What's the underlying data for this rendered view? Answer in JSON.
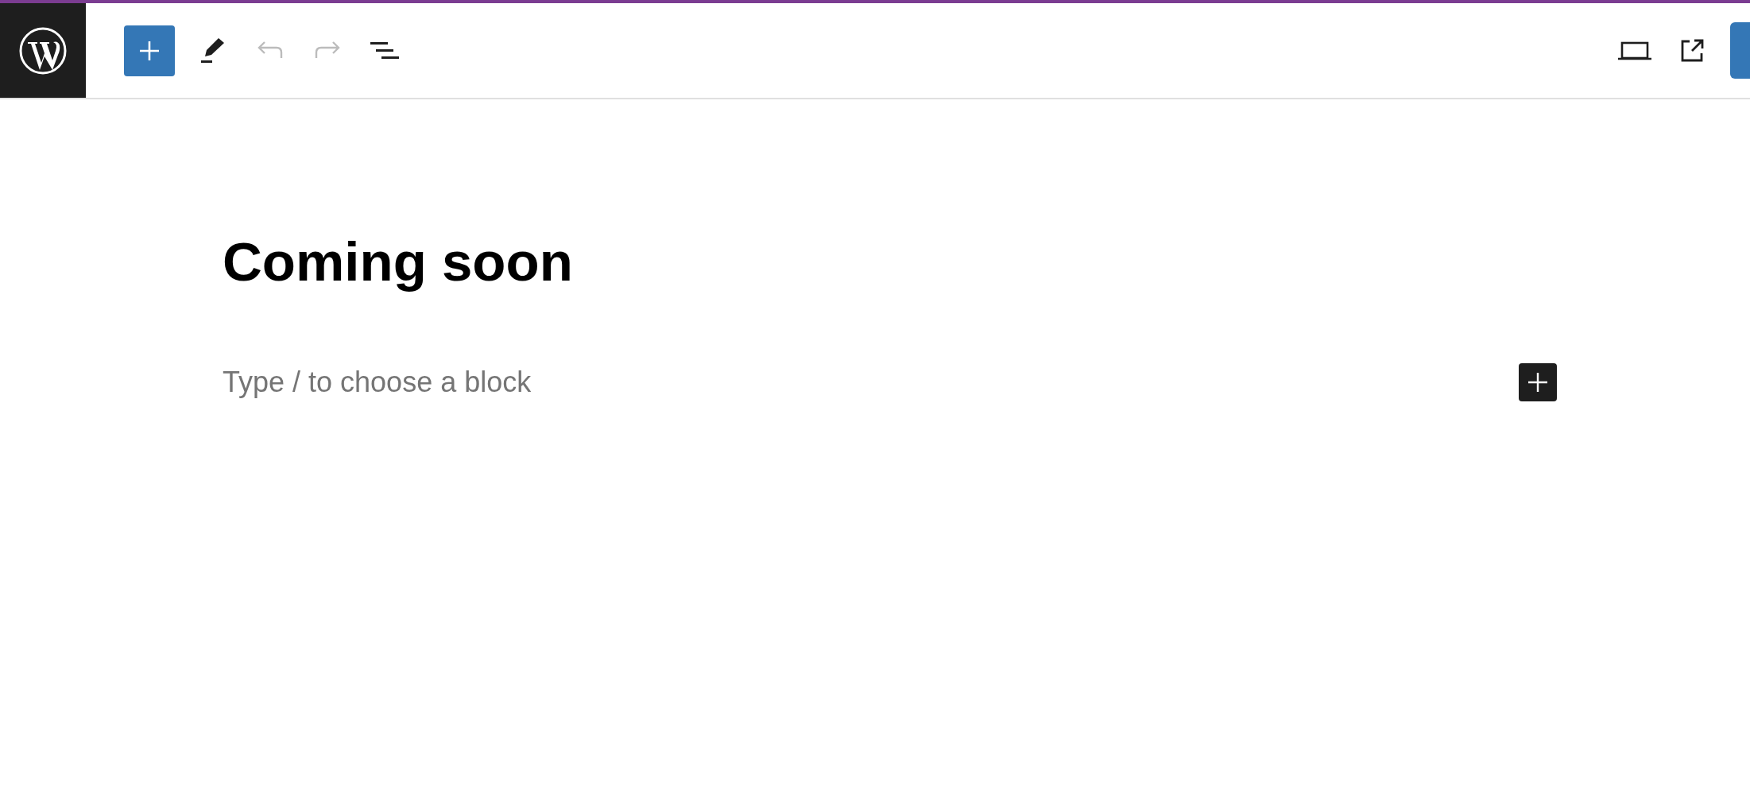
{
  "toolbar": {
    "undo": {
      "disabled": true
    },
    "redo": {
      "disabled": true
    }
  },
  "editor": {
    "title": "Coming soon",
    "block_placeholder": "Type / to choose a block"
  }
}
